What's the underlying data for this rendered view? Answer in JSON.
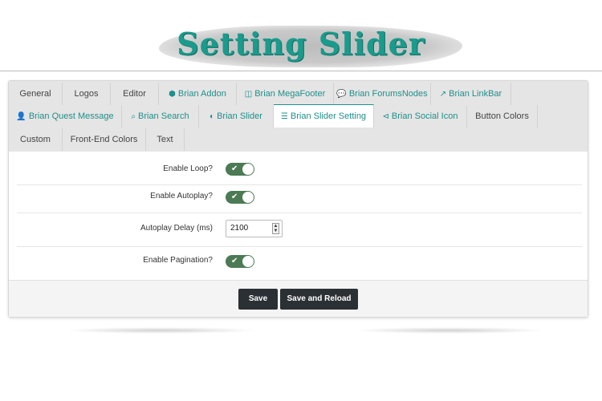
{
  "banner": {
    "title": "Setting Slider"
  },
  "tabs": {
    "row1": [
      {
        "label": "General",
        "icon": ""
      },
      {
        "label": "Logos",
        "icon": ""
      },
      {
        "label": "Editor",
        "icon": ""
      },
      {
        "label": "Brian Addon",
        "icon": "cube-icon"
      },
      {
        "label": "Brian MegaFooter",
        "icon": "columns-icon"
      },
      {
        "label": "Brian ForumsNodes",
        "icon": "comments-icon"
      },
      {
        "label": "Brian LinkBar",
        "icon": "external-link-icon"
      }
    ],
    "row2": [
      {
        "label": "Brian Quest Message",
        "icon": "user-plus-icon"
      },
      {
        "label": "Brian Search",
        "icon": "search-icon"
      },
      {
        "label": "Brian Slider",
        "icon": "toggle-icon"
      },
      {
        "label": "Brian Slider Setting",
        "icon": "sliders-icon",
        "active": true
      },
      {
        "label": "Brian Social Icon",
        "icon": "share-square-icon"
      },
      {
        "label": "Button Colors",
        "icon": ""
      }
    ],
    "row3": [
      {
        "label": "Custom",
        "icon": ""
      },
      {
        "label": "Front-End Colors",
        "icon": ""
      },
      {
        "label": "Text",
        "icon": ""
      }
    ]
  },
  "form": {
    "enable_loop": {
      "label": "Enable Loop?",
      "value": true
    },
    "enable_autoplay": {
      "label": "Enable Autoplay?",
      "value": true
    },
    "autoplay_delay": {
      "label": "Autoplay Delay (ms)",
      "value": "2100"
    },
    "enable_pagination": {
      "label": "Enable Pagination?",
      "value": true
    }
  },
  "buttons": {
    "save": "Save",
    "save_reload": "Save and Reload"
  },
  "colors": {
    "accent": "#1f8f8a",
    "toggle_on": "#4c7a55",
    "button_dark": "#2b3034",
    "banner_text": "#1a9b8c"
  }
}
